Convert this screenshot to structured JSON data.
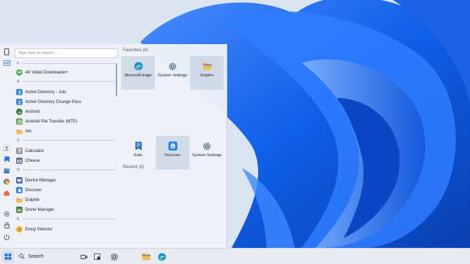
{
  "search": {
    "placeholder": "Type here to search ..."
  },
  "rail": {
    "top_icons": [
      "phone-icon",
      "app-library-icon"
    ],
    "bottom_icons": [
      "user-icon",
      "bookmark-icon",
      "image-icon",
      "chrome-icon",
      "home-icon",
      "settings-icon",
      "lock-icon",
      "power-icon"
    ]
  },
  "app_list": {
    "sections": [
      {
        "letter": "#",
        "apps": [
          {
            "label": "4K Video Downloader+",
            "icon": "video-downloader-icon",
            "color": "#4caf50"
          }
        ]
      },
      {
        "letter": "A",
        "apps": [
          {
            "label": "Active Directory - Join",
            "icon": "active-directory-icon",
            "color": "#3a8fd6"
          },
          {
            "label": "Active Directory Change Pass",
            "icon": "active-directory-icon",
            "color": "#3a8fd6"
          },
          {
            "label": "Android",
            "icon": "android-icon",
            "color": "#2e7d32"
          },
          {
            "label": "Android File Transfer (MTP)",
            "icon": "android-file-transfer-icon",
            "color": "#6aa84f"
          },
          {
            "label": "Ark",
            "icon": "folder-icon",
            "color": "#e8a33c"
          }
        ]
      },
      {
        "letter": "C",
        "apps": [
          {
            "label": "Calculator",
            "icon": "calculator-icon",
            "color": "#8b8f96"
          },
          {
            "label": "Cheese",
            "icon": "camera-icon",
            "color": "#5a6b80"
          }
        ]
      },
      {
        "letter": "D",
        "apps": [
          {
            "label": "Device Manager",
            "icon": "device-manager-icon",
            "color": "#3d5a99"
          },
          {
            "label": "Discover",
            "icon": "discover-icon",
            "color": "#2d8ae3"
          },
          {
            "label": "Dolphin",
            "icon": "folder-icon",
            "color": "#e8a33c"
          },
          {
            "label": "Driver Manager",
            "icon": "driver-manager-icon",
            "color": "#4c7a3a"
          }
        ]
      },
      {
        "letter": "E",
        "apps": [
          {
            "label": "Emoji Selector",
            "icon": "emoji-icon",
            "color": "#f2b630"
          }
        ]
      }
    ]
  },
  "favorites": {
    "header": "Favorites (6)",
    "tiles": [
      {
        "label": "Microsoft Edge",
        "icon": "edge-icon",
        "color": "#1f8fd8"
      },
      {
        "label": "System Settings",
        "icon": "settings-gear-icon",
        "color": "#5b6b80"
      },
      {
        "label": "Dolphin",
        "icon": "folder-icon",
        "color": "#e8a33c"
      },
      {
        "label": "Kate",
        "icon": "kate-icon",
        "color": "#2a6fcf"
      },
      {
        "label": "Discover",
        "icon": "discover-icon",
        "color": "#2d8ae3"
      },
      {
        "label": "System Settings",
        "icon": "settings-gear-icon",
        "color": "#5b6b80"
      }
    ]
  },
  "recent": {
    "header": "Recent (0)"
  },
  "taskbar": {
    "search_label": "Search",
    "items": [
      "task-view-icon",
      "widgets-icon",
      "settings-gear-icon",
      "folder-icon",
      "edge-icon"
    ]
  },
  "colors": {
    "accent": "#1f7ae0",
    "wallpaper_blue": "#0f5fe8"
  }
}
